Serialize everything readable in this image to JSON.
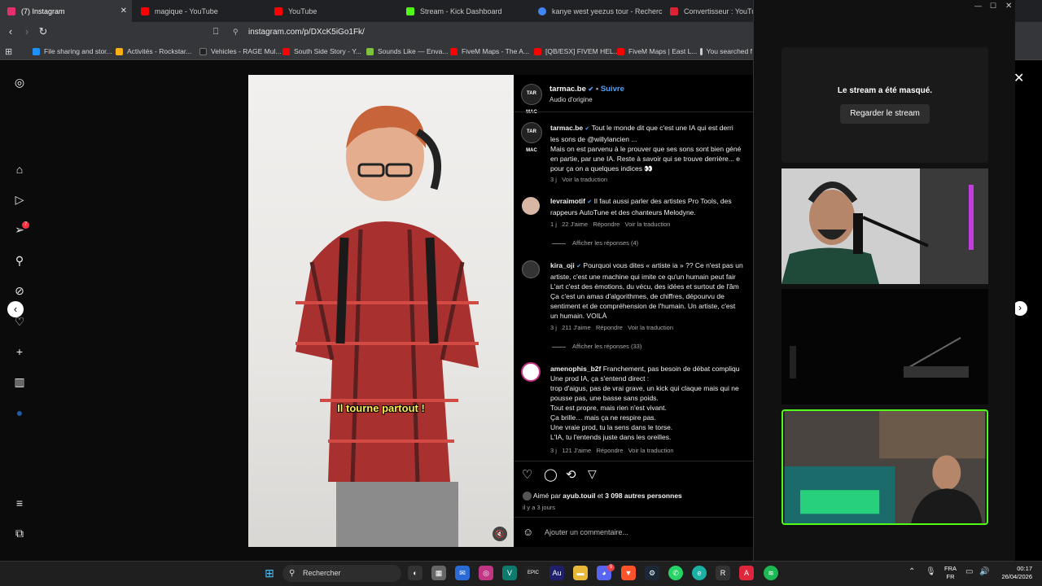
{
  "tabs": [
    {
      "label": "(7) Instagram",
      "color": "#e1306c"
    },
    {
      "label": "magique - YouTube",
      "color": "#ff0000"
    },
    {
      "label": "YouTube",
      "color": "#ff0000"
    },
    {
      "label": "Stream - Kick Dashboard",
      "color": "#53fc18"
    },
    {
      "label": "kanye west yeezus tour - Recherche",
      "color": "#4285f4"
    },
    {
      "label": "Convertisseur : YouTube",
      "color": "#d23"
    }
  ],
  "url": "instagram.com/p/DXcK5iGo1Fk/",
  "bookmarks": [
    "File sharing and stor...",
    "Activités - Rockstar...",
    "Vehicles - RAGE Mul...",
    "South Side Story - Y...",
    "Sounds Like — Enva...",
    "FiveM Maps - The A...",
    "[QB/ESX] FIVEM HEL...",
    "FiveM Maps | East L...",
    "You searched f"
  ],
  "sidebar_badge": "7",
  "video": {
    "caption": "Il tourne partout !"
  },
  "post": {
    "author": "tarmac.be",
    "follow": "Suivre",
    "audio": "Audio d'origine",
    "avatar_text": "TAR MAC"
  },
  "comments": [
    {
      "user": "tarmac.be",
      "lines": [
        "Tout le monde dit que c'est une IA qui est derri",
        "les sons de @willylancien ...",
        "Mais on est parvenu à le prouver que ses sons sont bien géné",
        "en partie, par une IA. Reste à savoir qui se trouve derrière... e",
        "pour ça on a quelques indices 👀"
      ],
      "mention": "@willylancien",
      "age": "3 j",
      "translate": "Voir la traduction"
    },
    {
      "user": "levraimotif",
      "lines": [
        "Il faut aussi parler des artistes Pro Tools, des",
        "rappeurs AutoTune et des chanteurs Melodyne."
      ],
      "age": "1 j",
      "likes": "22 J'aime",
      "reply": "Répondre",
      "translate": "Voir la traduction",
      "replies": "Afficher les réponses (4)"
    },
    {
      "user": "kira_oji",
      "lines": [
        "Pourquoi vous dites « artiste ia » ?? Ce n'est pas un",
        "artiste, c'est une machine qui imite ce qu'un humain peut fair",
        "L'art c'est des émotions, du vécu, des idées et surtout de l'âm",
        "Ça c'est un amas d'algorithmes, de chiffres, dépourvu de",
        "sentiment et de compréhension de l'humain. Un artiste, c'est",
        "un humain. VOILÀ"
      ],
      "age": "3 j",
      "likes": "211 J'aime",
      "reply": "Répondre",
      "translate": "Voir la traduction",
      "replies": "Afficher les réponses (33)"
    },
    {
      "user": "amenophis_b2f",
      "lines": [
        "Franchement, pas besoin de débat compliqu",
        "Une prod IA, ça s'entend direct :",
        "trop d'aigus, pas de vrai grave, un kick qui claque mais qui ne",
        "pousse pas, une basse sans poids.",
        "Tout est propre, mais rien n'est vivant.",
        "Ça brille… mais ça ne respire pas.",
        "Une vraie prod, tu la sens dans le torse.",
        "L'IA, tu l'entends juste dans les oreilles."
      ],
      "age": "3 j",
      "likes": "121 J'aime",
      "reply": "Répondre",
      "translate": "Voir la traduction"
    }
  ],
  "likes": {
    "prefix": "Aimé par",
    "user": "ayub.touil",
    "middle": "et",
    "count": "3 098 autres personnes"
  },
  "posted": "il y a 3 jours",
  "comment_placeholder": "Ajouter un commentaire...",
  "overlay": {
    "masked_text": "Le stream a été masqué.",
    "watch_button": "Regarder le stream"
  },
  "taskbar": {
    "search": "Rechercher",
    "lang1": "FRA",
    "lang2": "FR",
    "time": "00:17",
    "date": "26/04/2026",
    "discord_badge": "9"
  }
}
